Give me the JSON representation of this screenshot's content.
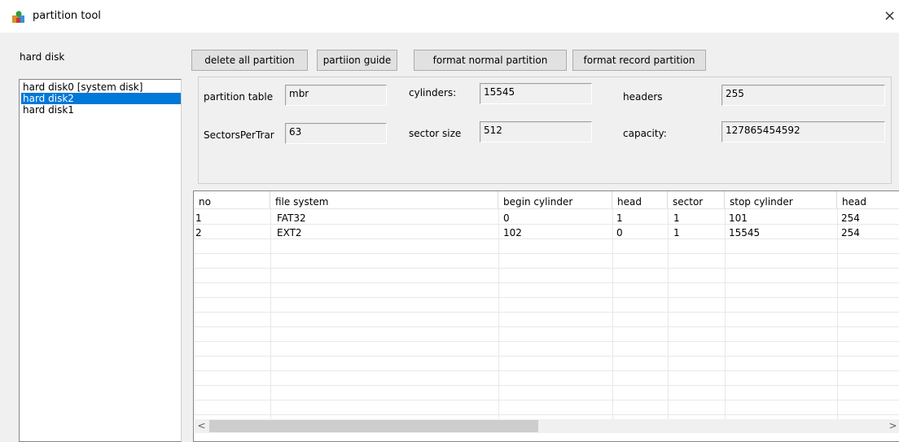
{
  "window": {
    "title": "partition tool",
    "close_glyph": "×",
    "icon": "partition-tool-app-icon"
  },
  "sidebar": {
    "label": "hard disk",
    "disks": [
      {
        "label": "hard disk0 [system disk]",
        "selected": false
      },
      {
        "label": "hard disk2",
        "selected": true
      },
      {
        "label": "hard disk1",
        "selected": false
      }
    ]
  },
  "toolbar": {
    "delete_all": "delete all partition",
    "guide": "partiion guide",
    "format_normal": "format normal partition",
    "format_record": "format record partition"
  },
  "info": {
    "partition_table_label": "partition table",
    "partition_table_value": "mbr",
    "cylinders_label": "cylinders:",
    "cylinders_value": "15545",
    "headers_label": "headers",
    "headers_value": "255",
    "sectors_label": "SectorsPerTrar",
    "sectors_value": "63",
    "sector_size_label": "sector size",
    "sector_size_value": "512",
    "capacity_label": "capacity:",
    "capacity_value": "127865454592"
  },
  "table": {
    "columns": [
      "no",
      "file system",
      "begin cylinder",
      "head",
      "sector",
      "stop cylinder",
      "head"
    ],
    "rows": [
      [
        "1",
        "FAT32",
        "0",
        "1",
        "1",
        "101",
        "254"
      ],
      [
        "2",
        "EXT2",
        "102",
        "0",
        "1",
        "15545",
        "254"
      ]
    ]
  },
  "scrollbar": {
    "left_glyph": "<",
    "right_glyph": ">"
  },
  "colors": {
    "selection": "#0078d7",
    "window_bg": "#f0f0f0"
  }
}
